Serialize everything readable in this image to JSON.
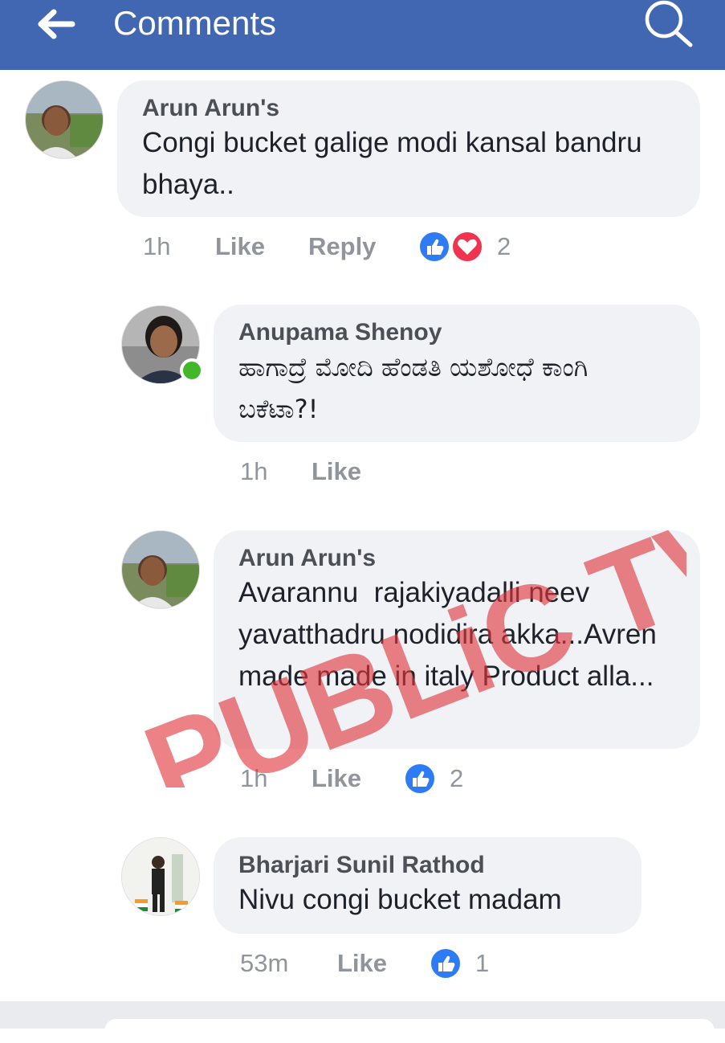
{
  "header": {
    "title": "Comments",
    "back_icon": "arrow-left-icon",
    "search_icon": "search-icon",
    "bar_color": "#4267b2"
  },
  "comments": [
    {
      "author": "Arun Arun's",
      "text": "Congi bucket galige modi kansal bandru bhaya..",
      "time": "1h",
      "like_label": "Like",
      "reply_label": "Reply",
      "reactions": [
        "like",
        "love"
      ],
      "reaction_count": "2"
    },
    {
      "author": "Anupama Shenoy",
      "text": "ಹಾಗಾದ್ರೆ ಮೋದಿ ಹೆಂಡತಿ ಯಶೋಧೆ ಕಾಂಗಿ ಬಕೆಟಾ?!",
      "time": "1h",
      "like_label": "Like",
      "online": true
    },
    {
      "author": "Arun Arun's",
      "text": "Avarannu  rajakiyadalli neev yavatthadru nodidira akka...Avren made made in italy Product alla...",
      "time": "1h",
      "like_label": "Like",
      "reactions": [
        "like"
      ],
      "reaction_count": "2"
    },
    {
      "author": "Bharjari Sunil Rathod",
      "text": "Nivu congi bucket madam",
      "time": "53m",
      "like_label": "Like",
      "reactions": [
        "like"
      ],
      "reaction_count": "1"
    }
  ],
  "watermark": {
    "text": "PUBLiC TV",
    "color": "#e0363c"
  },
  "colors": {
    "like_blue": "#2d7cf6",
    "love_red": "#f0334f",
    "online_green": "#42b72a",
    "bubble_bg": "#f0f2f5"
  }
}
